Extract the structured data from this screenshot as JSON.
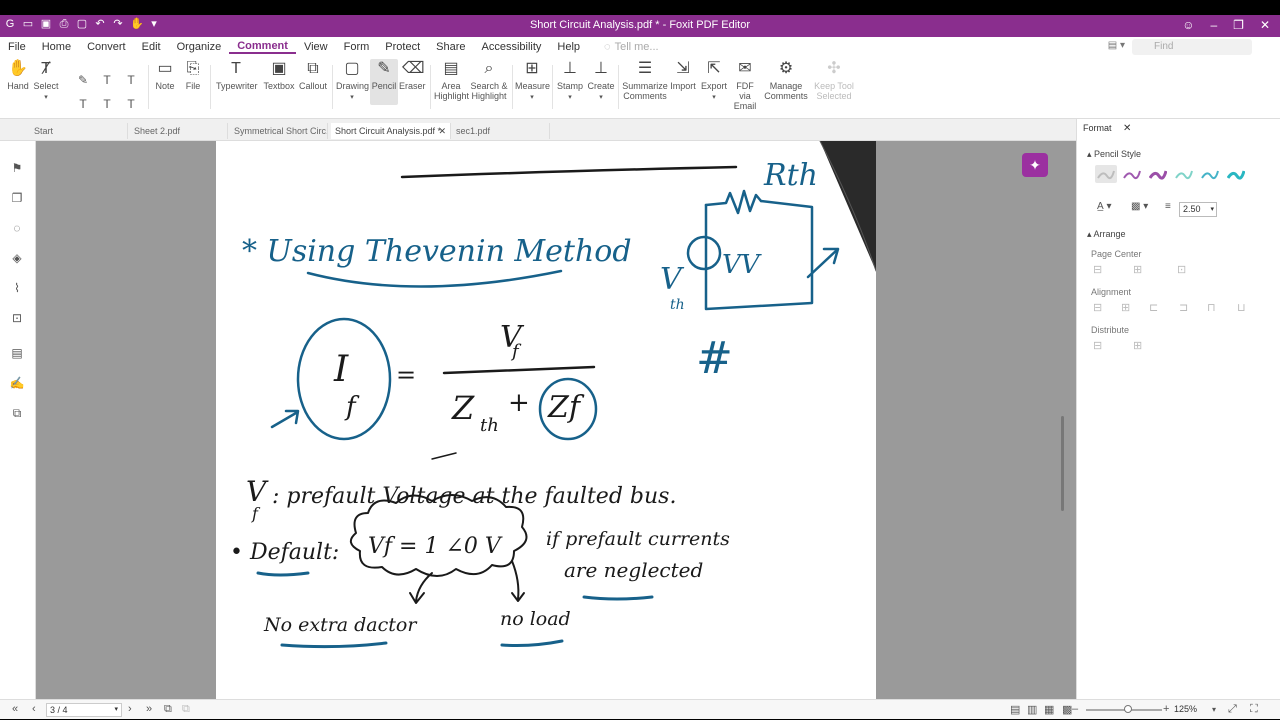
{
  "window": {
    "title": "Short Circuit Analysis.pdf * - Foxit PDF Editor"
  },
  "menu": {
    "items": [
      "File",
      "Home",
      "Convert",
      "Edit",
      "Organize",
      "Comment",
      "View",
      "Form",
      "Protect",
      "Share",
      "Accessibility",
      "Help"
    ],
    "active": "Comment",
    "tell_me": "Tell me...",
    "find_placeholder": "Find"
  },
  "ribbon": {
    "hand": "Hand",
    "select": "Select",
    "note": "Note",
    "file": "File",
    "typewriter": "Typewriter",
    "textbox": "Textbox",
    "callout": "Callout",
    "drawing": "Drawing",
    "pencil": "Pencil",
    "eraser": "Eraser",
    "area_highlight_1": "Area",
    "area_highlight_2": "Highlight",
    "search_highlight_1": "Search &",
    "search_highlight_2": "Highlight",
    "measure": "Measure",
    "stamp": "Stamp",
    "create": "Create",
    "summarize_1": "Summarize",
    "summarize_2": "Comments",
    "import": "Import",
    "export": "Export",
    "fdf_1": "FDF via",
    "fdf_2": "Email",
    "manage_1": "Manage",
    "manage_2": "Comments",
    "keep_tool_1": "Keep Tool",
    "keep_tool_2": "Selected"
  },
  "tabs": [
    {
      "label": "Start"
    },
    {
      "label": "Sheet 2.pdf"
    },
    {
      "label": "Symmetrical Short Circ..."
    },
    {
      "label": "Short Circuit Analysis.pdf *"
    },
    {
      "label": "sec1.pdf"
    }
  ],
  "handwriting": {
    "heading": "* Using Thevenin Method",
    "eq_I": "I",
    "eq_f": "f",
    "eq_equals": "=",
    "eq_V": "V",
    "eq_vf": "f",
    "eq_Z": "Z",
    "eq_th": "th",
    "eq_plus": "+",
    "eq_Zf": "Zf",
    "hash": "#",
    "rth": "Rth",
    "vth_V": "V",
    "vth_th": "th",
    "vv": "VV",
    "vf_def_V": "V",
    "vf_def_f": "f",
    "vf_def": ": prefault Voltage at the faulted bus.",
    "default_label": "• Default:",
    "cloud_text": "Vf = 1 ∠0  V",
    "if_prefault": "if prefault currents",
    "are_neglected": "are neglected",
    "no_extra": "No extra  dactor",
    "no_load": "no load"
  },
  "panel": {
    "tab": "Format",
    "pencil_style": "Pencil Style",
    "thickness": "2.50",
    "arrange": "Arrange",
    "page_center": "Page Center",
    "alignment": "Alignment",
    "distribute": "Distribute",
    "swatch_colors": [
      "#bdbdbd",
      "#a05ab0",
      "#9b4fa8",
      "#7fd3c8",
      "#45b3c8",
      "#29b7c2"
    ]
  },
  "status": {
    "page": "3 / 4",
    "zoom": "125%"
  },
  "colors": {
    "brand": "#8a2e8e",
    "ink": "#17618a",
    "pen": "#1a1a1a"
  }
}
